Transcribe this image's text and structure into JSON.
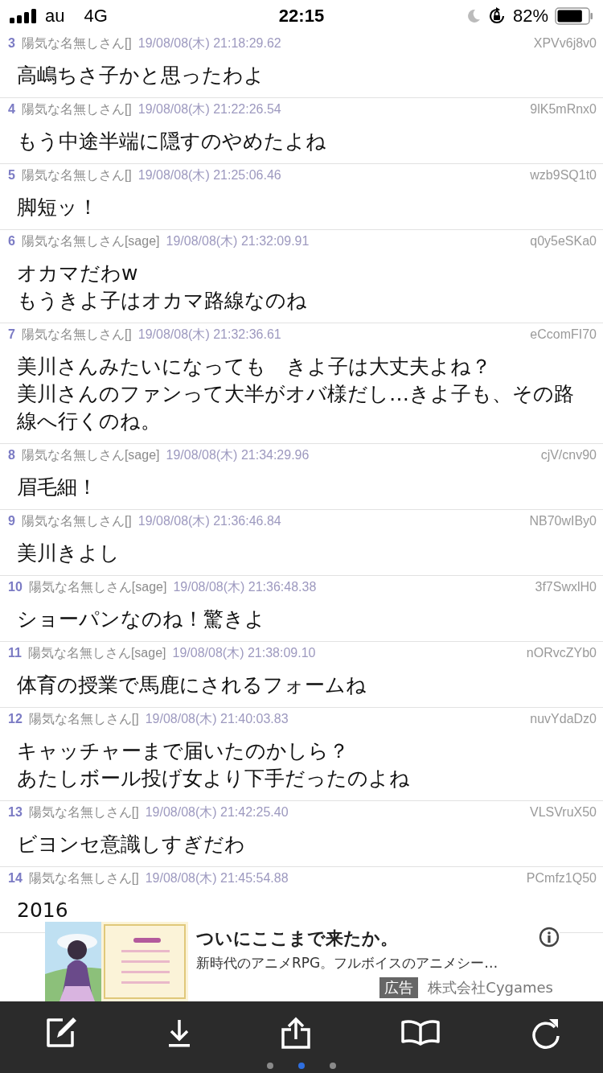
{
  "status_bar": {
    "carrier": "au",
    "network": "4G",
    "time": "22:15",
    "battery": "82%"
  },
  "posts": [
    {
      "number": "3",
      "name": "陽気な名無しさん[]",
      "date": "19/08/08(木) 21:18:29.62",
      "id": "XPVv6j8v0",
      "lines": [
        "高嶋ちさ子かと思ったわよ"
      ]
    },
    {
      "number": "4",
      "name": "陽気な名無しさん[]",
      "date": "19/08/08(木) 21:22:26.54",
      "id": "9lK5mRnx0",
      "lines": [
        "もう中途半端に隠すのやめたよね"
      ]
    },
    {
      "number": "5",
      "name": "陽気な名無しさん[]",
      "date": "19/08/08(木) 21:25:06.46",
      "id": "wzb9SQ1t0",
      "lines": [
        "脚短ッ！"
      ]
    },
    {
      "number": "6",
      "name": "陽気な名無しさん[sage]",
      "date": "19/08/08(木) 21:32:09.91",
      "id": "q0y5eSKa0",
      "lines": [
        "オカマだわw",
        "もうきよ子はオカマ路線なのね"
      ]
    },
    {
      "number": "7",
      "name": "陽気な名無しさん[]",
      "date": "19/08/08(木) 21:32:36.61",
      "id": "eCcomFI70",
      "lines": [
        "美川さんみたいになっても　きよ子は大丈夫よね？",
        "美川さんのファンって大半がオバ様だし…きよ子も、その路線へ行くのね。"
      ]
    },
    {
      "number": "8",
      "name": "陽気な名無しさん[sage]",
      "date": "19/08/08(木) 21:34:29.96",
      "id": "cjV/cnv90",
      "lines": [
        "眉毛細！"
      ]
    },
    {
      "number": "9",
      "name": "陽気な名無しさん[]",
      "date": "19/08/08(木) 21:36:46.84",
      "id": "NB70wIBy0",
      "lines": [
        "美川きよし"
      ]
    },
    {
      "number": "10",
      "name": "陽気な名無しさん[sage]",
      "date": "19/08/08(木) 21:36:48.38",
      "id": "3f7SwxlH0",
      "lines": [
        "ショーパンなのね！驚きよ"
      ]
    },
    {
      "number": "11",
      "name": "陽気な名無しさん[sage]",
      "date": "19/08/08(木) 21:38:09.10",
      "id": "nORvcZYb0",
      "lines": [
        "体育の授業で馬鹿にされるフォームね"
      ]
    },
    {
      "number": "12",
      "name": "陽気な名無しさん[]",
      "date": "19/08/08(木) 21:40:03.83",
      "id": "nuvYdaDz0",
      "lines": [
        "キャッチャーまで届いたのかしら？",
        "あたしボール投げ女より下手だったのよね"
      ]
    },
    {
      "number": "13",
      "name": "陽気な名無しさん[]",
      "date": "19/08/08(木) 21:42:25.40",
      "id": "VLSVruX50",
      "lines": [
        "ビヨンセ意識しすぎだわ"
      ]
    },
    {
      "number": "14",
      "name": "陽気な名無しさん[]",
      "date": "19/08/08(木) 21:45:54.88",
      "id": "PCmfz1Q50",
      "lines": [
        "2016"
      ]
    }
  ],
  "ad": {
    "title": "ついにここまで来たか。",
    "description": "新時代のアニメRPG。フルボイスのアニメシー…",
    "label": "広告",
    "advertiser": "株式会社Cygames"
  },
  "page_dots": [
    {
      "selected": false
    },
    {
      "selected": true
    },
    {
      "selected": false
    }
  ]
}
